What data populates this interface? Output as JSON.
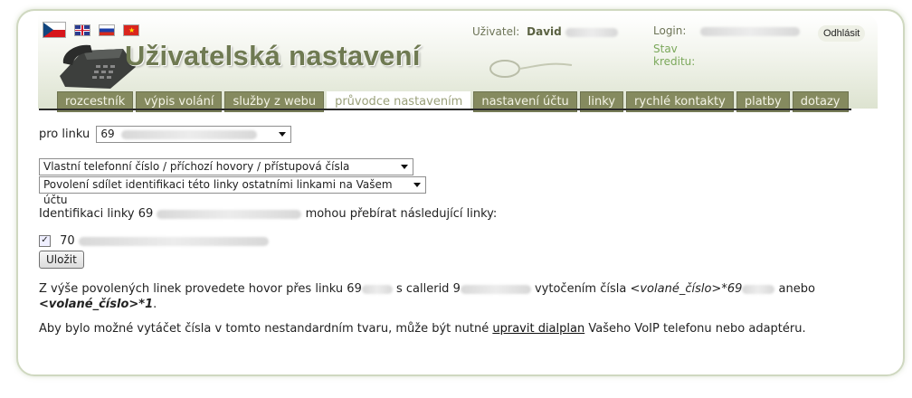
{
  "header": {
    "title": "Uživatelská nastavení",
    "user_label": "Uživatel:",
    "user_name": "David",
    "login_label": "Login:",
    "credit_label": "Stav kreditu:",
    "logout_label": "Odhlásit",
    "flags": [
      "czech-flag",
      "uk-flag",
      "russia-flag",
      "vietnam-flag"
    ]
  },
  "tabs": [
    {
      "label": "rozcestník"
    },
    {
      "label": "výpis volání"
    },
    {
      "label": "služby z webu"
    },
    {
      "label": "průvodce nastavením",
      "active": true
    },
    {
      "label": "nastavení účtu"
    },
    {
      "label": "linky"
    },
    {
      "label": "rychlé kontakty"
    },
    {
      "label": "platby"
    },
    {
      "label": "dotazy"
    }
  ],
  "form": {
    "line_label": "pro linku",
    "line_value": "69",
    "select1": "Vlastní telefonní číslo / příchozí hovory / přístupová čísla",
    "select2": "Povolení sdílet identifikaci této linky ostatními linkami na Vašem účtu",
    "ident_prefix": "Identifikaci linky 69",
    "ident_suffix": "mohou přebírat následující linky:",
    "checkbox_value": "70",
    "checkbox_checked": true,
    "save_label": "Uložit"
  },
  "info": {
    "p1_a": "Z výše povolených linek provedete hovor přes linku 69",
    "p1_b": "s callerid 9",
    "p1_c": "vytočením čísla",
    "p1_code1": "<volané_číslo>*69",
    "p1_d": "anebo",
    "p1_code2": "<volané_číslo>*1",
    "p1_end": ".",
    "p2_a": "Aby bylo možné vytáčet čísla v tomto nestandardním tvaru, může být nutné",
    "p2_link": "upravit dialplan",
    "p2_b": "Vašeho VoIP telefonu nebo adaptéru."
  },
  "colors": {
    "accent": "#858a5f",
    "title": "#6f7a52",
    "credit": "#7ba85b"
  }
}
